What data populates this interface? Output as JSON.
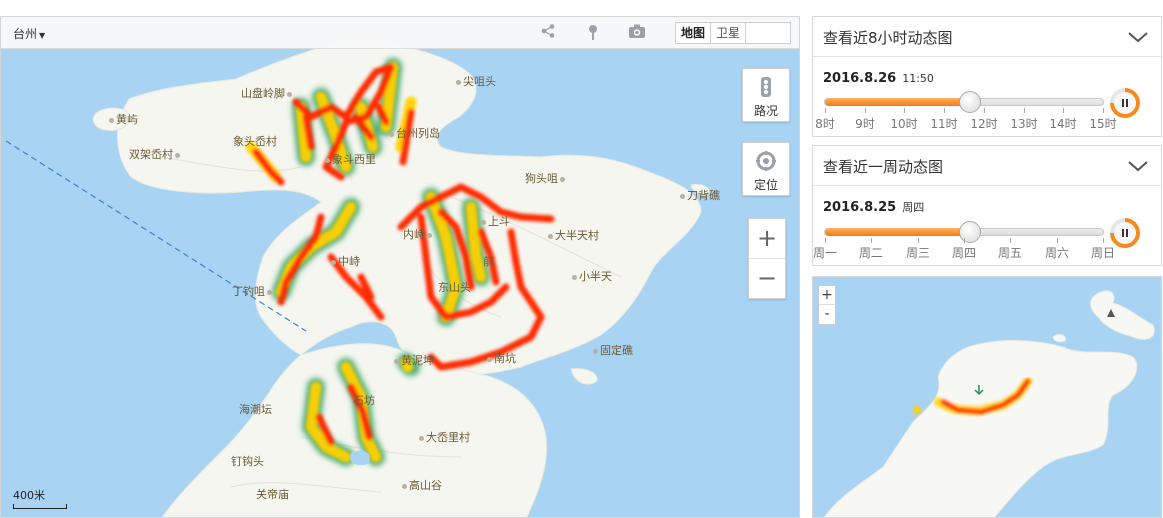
{
  "map": {
    "city": "台州",
    "maptype": {
      "map": "地图",
      "satellite": "卫星"
    },
    "icons": [
      "share-icon",
      "location-pin-icon",
      "camera-icon"
    ],
    "traffic_label": "路况",
    "locate_label": "定位",
    "zoom_in": "+",
    "zoom_out": "−",
    "scale_label": "400米",
    "places": [
      "尖咀头",
      "山盘岭脚",
      "黄屿",
      "象头岙村",
      "台州列岛",
      "双架岙村",
      "象斗西里",
      "狗头咀",
      "刀背礁",
      "上斗",
      "内峙",
      "大半天村",
      "中峙",
      "前",
      "小半天",
      "丁钓咀",
      "东山头",
      "黄泥坤",
      "南坑",
      "固定礁",
      "海潮坛",
      "石坊",
      "大岙里村",
      "钉钩头",
      "高山谷",
      "关帝庙"
    ],
    "colors": {
      "water": "#a9d3f3",
      "land": "#f4f6ef",
      "heat_high": "#ff1a00",
      "heat_mid": "#ffd400",
      "heat_low": "#2d9b66"
    }
  },
  "panels": {
    "hours": {
      "title": "查看近8小时动态图",
      "date": "2016.8.26",
      "sub": "11:50",
      "ticks": [
        "8时",
        "9时",
        "10时",
        "11时",
        "12时",
        "13时",
        "14时",
        "15时"
      ],
      "progress": 0.52
    },
    "week": {
      "title": "查看近一周动态图",
      "date": "2016.8.25",
      "sub": "周四",
      "ticks": [
        "周一",
        "周二",
        "周三",
        "周四",
        "周五",
        "周六",
        "周日"
      ],
      "progress": 0.52
    }
  },
  "minimap": {
    "zoom_in": "+",
    "zoom_out": "-"
  }
}
